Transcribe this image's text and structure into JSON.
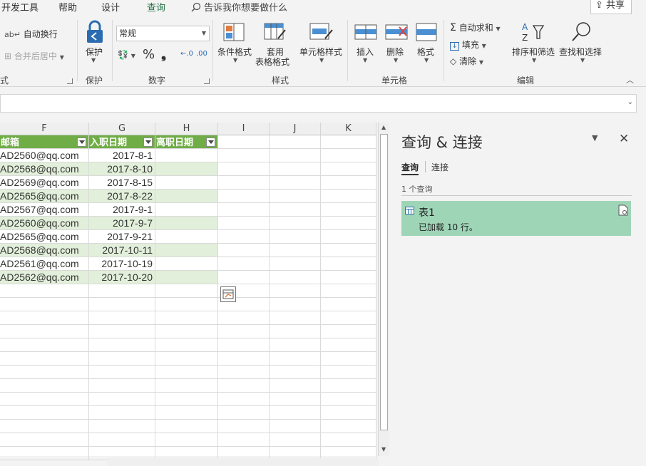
{
  "tabs": [
    "开发工具",
    "帮助",
    "设计",
    "查询"
  ],
  "tell_me": "告诉我你想要做什么",
  "share": "共享",
  "ribbon": {
    "alignment": {
      "wrap": "自动换行",
      "merge": "合并后居中",
      "label": "式"
    },
    "protect": {
      "button": "保护",
      "label": "保护"
    },
    "number": {
      "format": "常规",
      "percent": "%",
      "comma": "❟",
      "label": "数字"
    },
    "styles": {
      "conditional": "条件格式",
      "table_line1": "套用",
      "table_line2": "表格格式",
      "cell_styles": "单元格样式",
      "label": "样式"
    },
    "cells": {
      "insert": "插入",
      "delete": "删除",
      "format": "格式",
      "label": "单元格"
    },
    "editing": {
      "autosum": "自动求和",
      "fill": "填充",
      "clear": "清除",
      "sort": "排序和筛选",
      "find": "查找和选择",
      "label": "编辑"
    }
  },
  "columns": [
    "F",
    "G",
    "H",
    "I",
    "J",
    "K"
  ],
  "table": {
    "headers": [
      "邮箱",
      "入职日期",
      "离职日期"
    ],
    "rows": [
      [
        "AD2560@qq.com",
        "2017-8-1",
        ""
      ],
      [
        "AD2568@qq.com",
        "2017-8-10",
        ""
      ],
      [
        "AD2569@qq.com",
        "2017-8-15",
        ""
      ],
      [
        "AD2565@qq.com",
        "2017-8-22",
        ""
      ],
      [
        "AD2567@qq.com",
        "2017-9-1",
        ""
      ],
      [
        "AD2560@qq.com",
        "2017-9-7",
        ""
      ],
      [
        "AD2565@qq.com",
        "2017-9-21",
        ""
      ],
      [
        "AD2568@qq.com",
        "2017-10-11",
        ""
      ],
      [
        "AD2561@qq.com",
        "2017-10-19",
        ""
      ],
      [
        "AD2562@qq.com",
        "2017-10-20",
        ""
      ]
    ]
  },
  "panel": {
    "title": "查询 & 连接",
    "tab_queries": "查询",
    "tab_connections": "连接",
    "count": "1 个查询",
    "query_name": "表1",
    "query_status": "已加载 10 行。"
  },
  "colors": {
    "header_green": "#70ad47",
    "band_green": "#e2efda",
    "query_bg": "#9fd5b7",
    "accent": "#217346"
  }
}
